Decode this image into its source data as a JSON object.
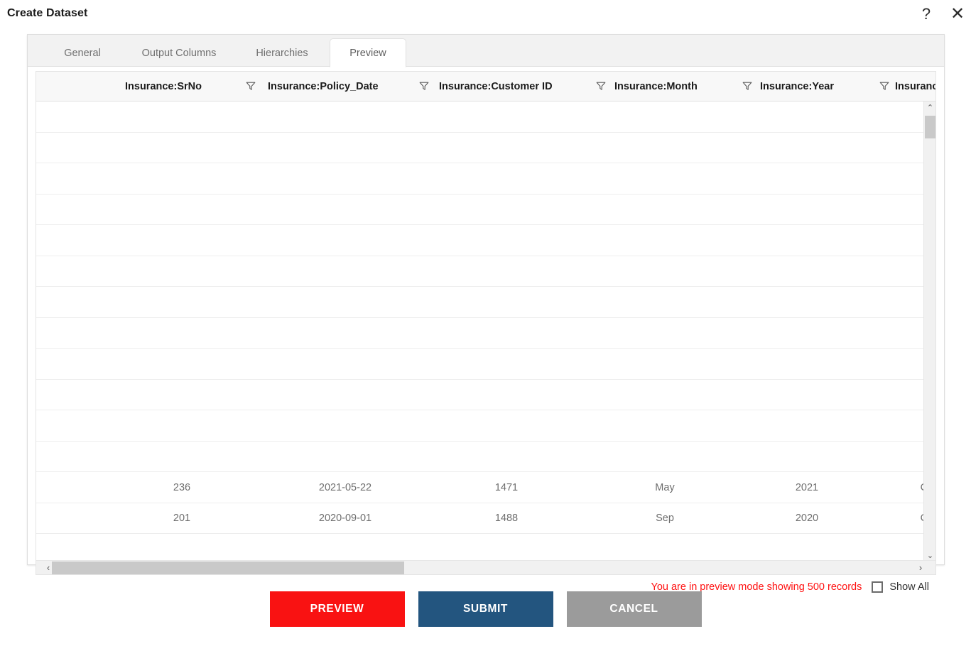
{
  "titlebar": {
    "title": "Create Dataset",
    "help_icon": "question-mark-icon",
    "help_glyph": "?",
    "close_icon": "close-icon",
    "close_glyph": "✕"
  },
  "tabs": [
    {
      "label": "General",
      "active": false
    },
    {
      "label": "Output Columns",
      "active": false
    },
    {
      "label": "Hierarchies",
      "active": false
    },
    {
      "label": "Preview",
      "active": true
    }
  ],
  "grid": {
    "columns": [
      {
        "label": "Insurance:SrNo",
        "filter_icon": "filter-funnel-icon"
      },
      {
        "label": "Insurance:Policy_Date",
        "filter_icon": "filter-funnel-icon"
      },
      {
        "label": "Insurance:Customer ID",
        "filter_icon": "filter-funnel-icon"
      },
      {
        "label": "Insurance:Month",
        "filter_icon": "filter-funnel-icon"
      },
      {
        "label": "Insurance:Year",
        "filter_icon": "filter-funnel-icon"
      },
      {
        "label": "Insurance:C",
        "filter_icon": null
      }
    ],
    "rows": [
      {
        "SrNo": "",
        "Policy_Date": "",
        "Customer ID": "",
        "Month": "",
        "Year": "",
        "C": ""
      },
      {
        "SrNo": "",
        "Policy_Date": "",
        "Customer ID": "",
        "Month": "",
        "Year": "",
        "C": ""
      },
      {
        "SrNo": "",
        "Policy_Date": "",
        "Customer ID": "",
        "Month": "",
        "Year": "",
        "C": ""
      },
      {
        "SrNo": "",
        "Policy_Date": "",
        "Customer ID": "",
        "Month": "",
        "Year": "",
        "C": ""
      },
      {
        "SrNo": "",
        "Policy_Date": "",
        "Customer ID": "",
        "Month": "",
        "Year": "",
        "C": ""
      },
      {
        "SrNo": "",
        "Policy_Date": "",
        "Customer ID": "",
        "Month": "",
        "Year": "",
        "C": ""
      },
      {
        "SrNo": "",
        "Policy_Date": "",
        "Customer ID": "",
        "Month": "",
        "Year": "",
        "C": ""
      },
      {
        "SrNo": "",
        "Policy_Date": "",
        "Customer ID": "",
        "Month": "",
        "Year": "",
        "C": ""
      },
      {
        "SrNo": "",
        "Policy_Date": "",
        "Customer ID": "",
        "Month": "",
        "Year": "",
        "C": ""
      },
      {
        "SrNo": "",
        "Policy_Date": "",
        "Customer ID": "",
        "Month": "",
        "Year": "",
        "C": ""
      },
      {
        "SrNo": "",
        "Policy_Date": "",
        "Customer ID": "",
        "Month": "",
        "Year": "",
        "C": ""
      },
      {
        "SrNo": "",
        "Policy_Date": "",
        "Customer ID": "",
        "Month": "",
        "Year": "",
        "C": ""
      },
      {
        "SrNo": "236",
        "Policy_Date": "2021-05-22",
        "Customer ID": "1471",
        "Month": "May",
        "Year": "2021",
        "C": "Canada"
      },
      {
        "SrNo": "201",
        "Policy_Date": "2020-09-01",
        "Customer ID": "1488",
        "Month": "Sep",
        "Year": "2020",
        "C": "Canada"
      }
    ],
    "v_scrollbar": {
      "up_icon": "chevron-up-icon",
      "up_glyph": "⌃",
      "down_icon": "chevron-down-icon",
      "down_glyph": "⌄"
    },
    "h_scrollbar": {
      "left_icon": "chevron-left-icon",
      "left_glyph": "‹",
      "right_icon": "chevron-right-icon",
      "right_glyph": "›"
    }
  },
  "footer": {
    "preview_notice": "You are in preview mode showing 500 records",
    "show_all_label": "Show All",
    "show_all_checked": false,
    "notice_color": "#ff1111"
  },
  "actions": [
    {
      "label": "PREVIEW",
      "color": "#f91212"
    },
    {
      "label": "SUBMIT",
      "color": "#23557f"
    },
    {
      "label": "CANCEL",
      "color": "#9b9b9b"
    }
  ]
}
